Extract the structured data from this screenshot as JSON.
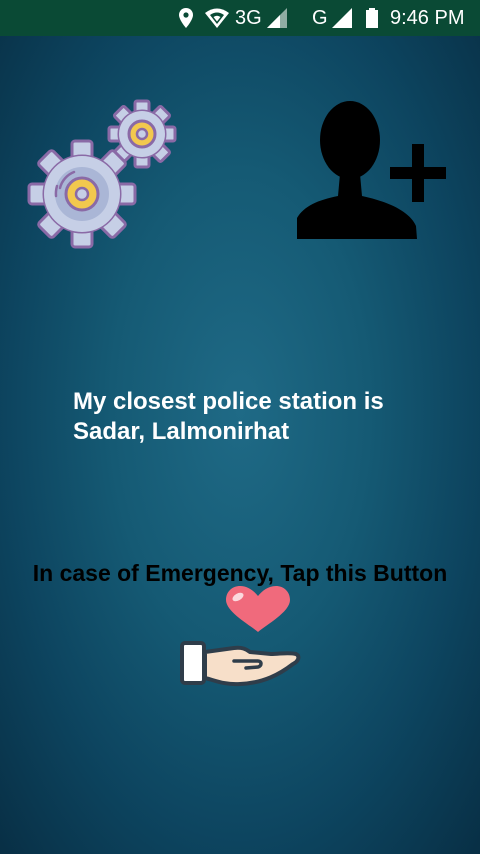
{
  "status_bar": {
    "network_primary": "3G",
    "network_secondary": "G",
    "time": "9:46 PM",
    "icons": [
      "location-icon",
      "wifi-icon",
      "signal-icon",
      "signal-icon",
      "battery-icon"
    ],
    "background_color": "#0a4a35"
  },
  "header_icons": {
    "settings": "gear-icon",
    "add_user": "add-user-icon"
  },
  "station": {
    "line1": "My closest police station is",
    "line2": "Sadar, Lalmonirhat"
  },
  "emergency": {
    "label": "In case of Emergency, Tap this Button",
    "icon": "heart-in-hand-icon"
  },
  "colors": {
    "background_center": "#1f6a86",
    "background_edge": "#082f45",
    "gear_fill": "#c6cfe6",
    "gear_outline": "#8a6aa6",
    "gear_center": "#f2c84e",
    "heart": "#f06a7c",
    "text_primary": "#ffffff",
    "text_emergency": "#000000"
  }
}
